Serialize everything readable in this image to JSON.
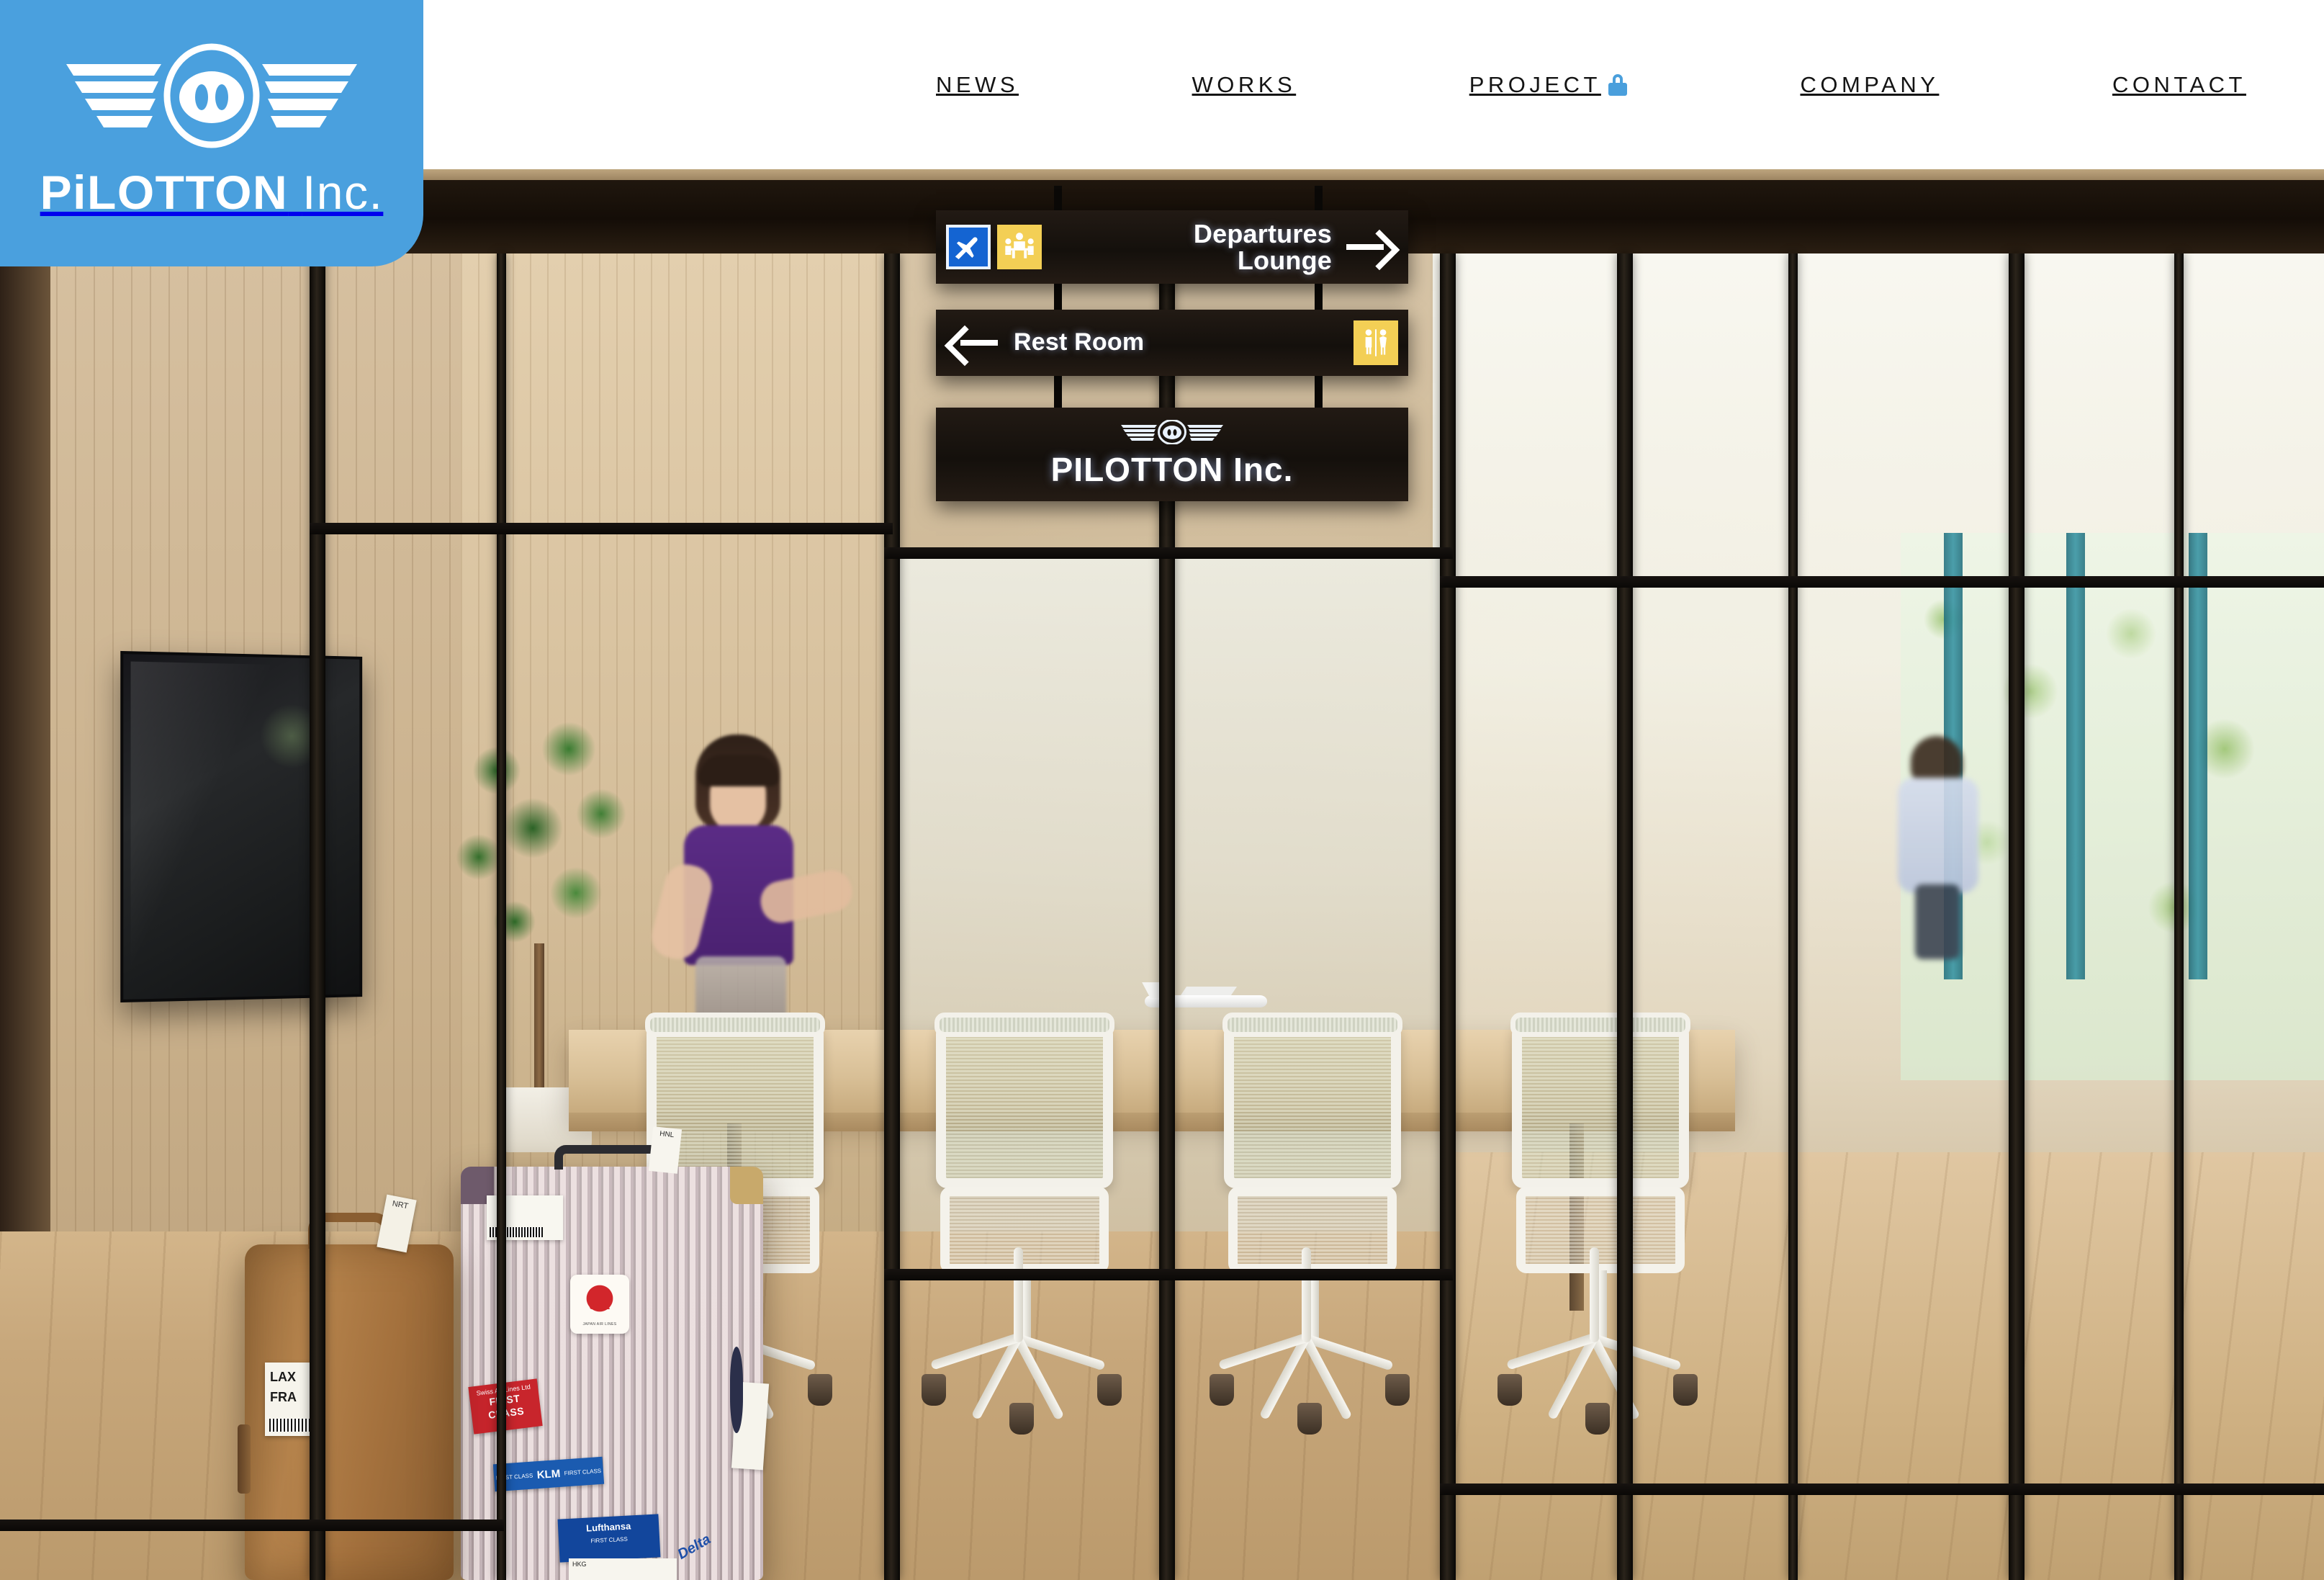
{
  "site": {
    "brand_name": "PiLOTTON Inc.",
    "brand_prefix": "PiLOTTON",
    "brand_suffix": "Inc.",
    "accent_color": "#4aa0de",
    "header_bg": "#ffffff",
    "logo_emblem_name": "winged-pig-snout-emblem"
  },
  "nav": {
    "items": [
      {
        "label": "NEWS",
        "badge": null
      },
      {
        "label": "WORKS",
        "badge": null
      },
      {
        "label": "PROJECT",
        "badge": "lock-icon"
      },
      {
        "label": "COMPANY",
        "badge": null
      },
      {
        "label": "CONTACT",
        "badge": null
      }
    ]
  },
  "hero": {
    "description": "Office interior photographed through black-framed glass partitions, styled like an airport departures lounge",
    "signs": [
      {
        "id": "departures",
        "text_line1": "Departures",
        "text_line2": "Lounge",
        "arrow": "right-arrow-icon",
        "pictograms": [
          "airplane-departure-icon",
          "lounge-seating-icon"
        ]
      },
      {
        "id": "restroom",
        "text": "Rest Room",
        "arrow": "left-arrow-icon",
        "pictograms": [
          "restroom-icon"
        ]
      },
      {
        "id": "brand",
        "text": "PILOTTON Inc.",
        "emblem": "winged-pig-snout-emblem"
      }
    ],
    "luggage": {
      "brown_case": {
        "tag_code": "NRT",
        "stickers": [
          "LAX",
          "FRA"
        ]
      },
      "aluminium_case": {
        "tag_code": "HNL",
        "bottom_tag": "HKG",
        "stickers": [
          {
            "airline": "JAL",
            "sub": "JAPAN AIR LINES"
          },
          {
            "airline": "Swiss Air Lines Ltd",
            "class": "FIRST CLASS"
          },
          {
            "airline": "KLM",
            "class": "FIRST CLASS"
          },
          {
            "airline": "Lufthansa",
            "class": "FIRST CLASS"
          },
          {
            "airline": "Delta",
            "class": ""
          }
        ]
      }
    },
    "table_item": "model-airplane"
  }
}
